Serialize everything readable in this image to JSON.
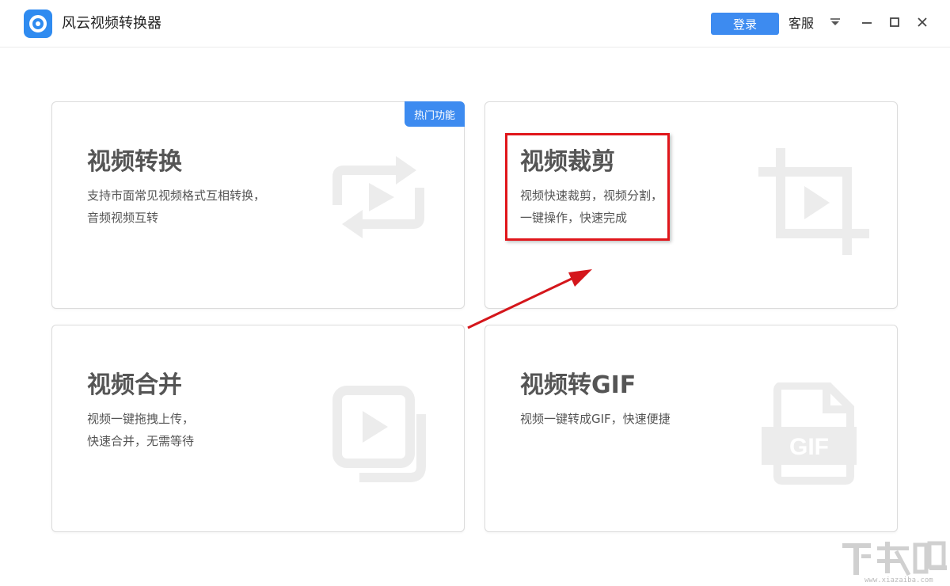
{
  "app": {
    "title": "风云视频转换器",
    "logo_icon": "app-logo-icon",
    "brand_color": "#3d8bf0"
  },
  "header": {
    "login_label": "登录",
    "service_label": "客服",
    "menu_icon": "dropdown-menu-icon",
    "minimize_icon": "minimize-icon",
    "maximize_icon": "maximize-icon",
    "close_icon": "close-icon"
  },
  "cards": [
    {
      "title": "视频转换",
      "desc_line1": "支持市面常见视频格式互相转换，",
      "desc_line2": "音频视频互转",
      "badge": "热门功能",
      "icon": "convert-play-icon"
    },
    {
      "title": "视频裁剪",
      "desc_line1": "视频快速裁剪，视频分割，",
      "desc_line2": "一键操作，快速完成",
      "icon": "crop-play-icon"
    },
    {
      "title": "视频合并",
      "desc_line1": "视频一键拖拽上传，",
      "desc_line2": "快速合并，无需等待",
      "icon": "merge-play-icon"
    },
    {
      "title": "视频转GIF",
      "desc_line1": "视频一键转成GIF，快速便捷",
      "desc_line2": "",
      "icon_text": "GIF",
      "icon": "gif-file-icon"
    }
  ],
  "annotation": {
    "highlight_color": "#e0161b"
  },
  "watermark": {
    "url": "www.xiazaiba.com"
  }
}
